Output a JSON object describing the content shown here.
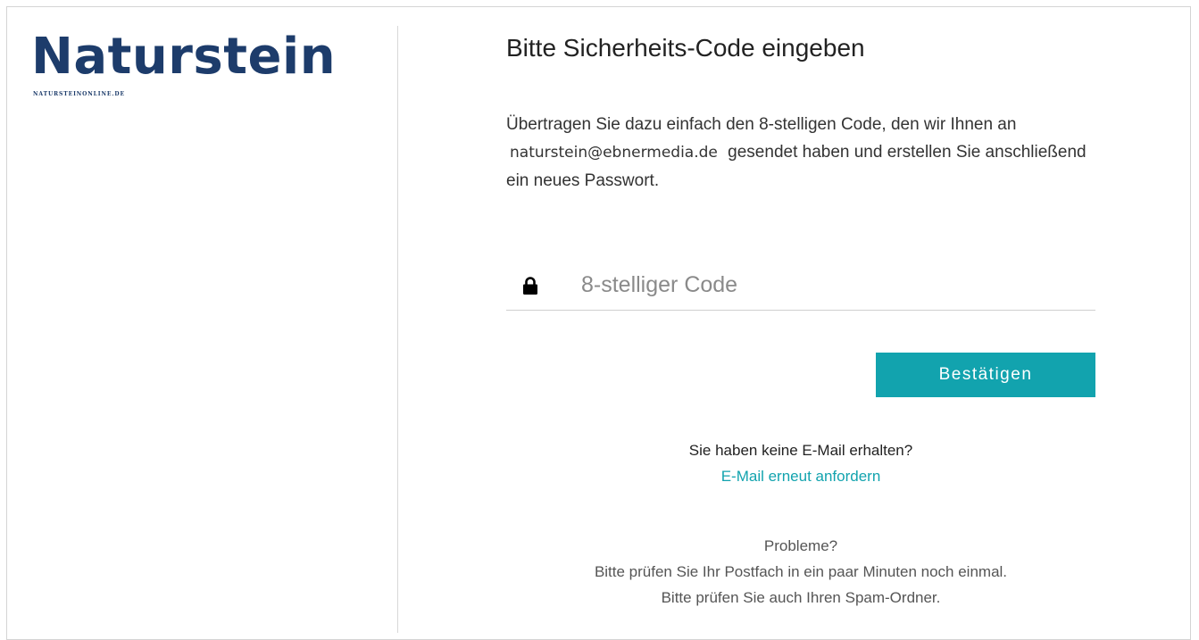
{
  "logo": {
    "word": "Naturstein",
    "subline": "NATURSTEINONLINE.DE"
  },
  "form": {
    "title": "Bitte Sicherheits-Code eingeben",
    "instructions_before": "Übertragen Sie dazu einfach den 8-stelligen Code, den wir Ihnen an",
    "email": "naturstein@ebnermedia.de",
    "instructions_after": "gesendet haben und erstellen Sie anschließend ein neues Passwort.",
    "code_placeholder": "8-stelliger Code",
    "code_value": "",
    "confirm_label": "Bestätigen",
    "no_mail_text": "Sie haben keine E-Mail erhalten?",
    "resend_link": "E-Mail erneut anfordern",
    "problems": {
      "heading": "Probleme?",
      "line1": "Bitte prüfen Sie Ihr Postfach in ein paar Minuten noch einmal.",
      "line2": "Bitte prüfen Sie auch Ihren Spam-Ordner."
    }
  },
  "icons": {
    "lock": "lock-icon"
  },
  "colors": {
    "brand": "#1d3c6b",
    "accent": "#12a3ae"
  }
}
